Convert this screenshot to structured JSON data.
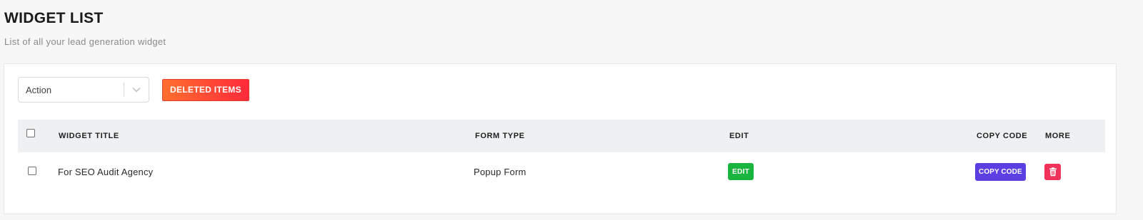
{
  "header": {
    "title": "WIDGET LIST",
    "subtitle": "List of all your lead generation widget"
  },
  "toolbar": {
    "action_select": {
      "value": "Action",
      "icon": "chevron-down-icon"
    },
    "deleted_items_label": "DELETED ITEMS"
  },
  "table": {
    "columns": {
      "title": "WIDGET TITLE",
      "form_type": "FORM TYPE",
      "edit": "EDIT",
      "copy_code": "COPY CODE",
      "more": "MORE"
    },
    "rows": [
      {
        "title": "For SEO Audit Agency",
        "form_type": "Popup Form",
        "edit_label": "EDIT",
        "copy_code_label": "COPY CODE",
        "more_icon": "trash-icon"
      }
    ]
  },
  "colors": {
    "deleted_button_start": "#ff6f2e",
    "deleted_button_end": "#ff2a3a",
    "edit_button": "#19b53e",
    "copy_button": "#5b3fe2",
    "delete_button": "#f0315a",
    "table_header_bg": "#eef0f2"
  }
}
